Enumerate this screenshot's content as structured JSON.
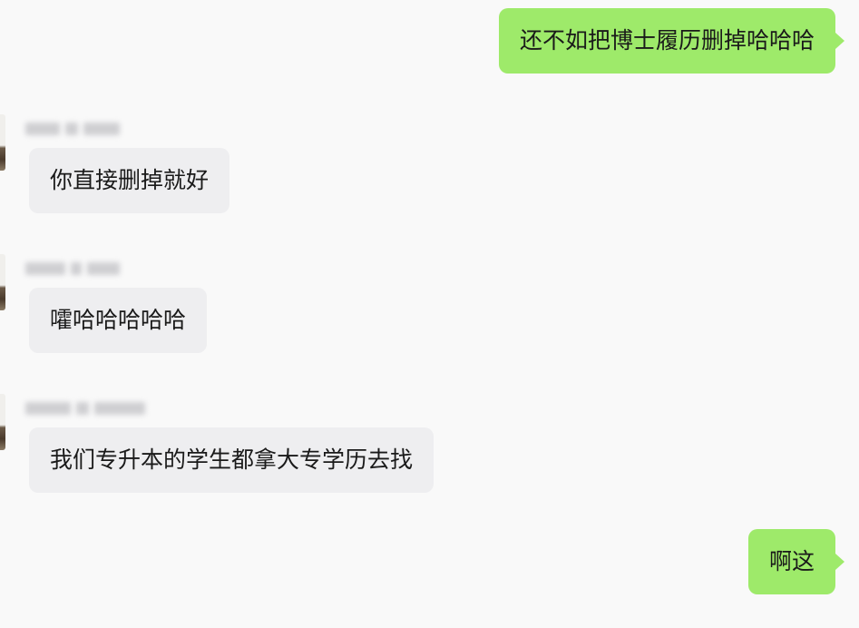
{
  "messages": [
    {
      "side": "sent",
      "text": "还不如把博士履历删掉哈哈哈"
    },
    {
      "side": "received",
      "sender": "blurred",
      "text": "你直接删掉就好"
    },
    {
      "side": "received",
      "sender": "blurred",
      "text": "嚯哈哈哈哈哈"
    },
    {
      "side": "received",
      "sender": "blurred",
      "text": "我们专升本的学生都拿大专学历去找"
    },
    {
      "side": "sent",
      "text": "啊这"
    }
  ],
  "colors": {
    "background": "#f9f9f9",
    "sent_bubble": "#9eea6a",
    "received_bubble": "#eeeef0",
    "text": "#1a1a1a"
  }
}
